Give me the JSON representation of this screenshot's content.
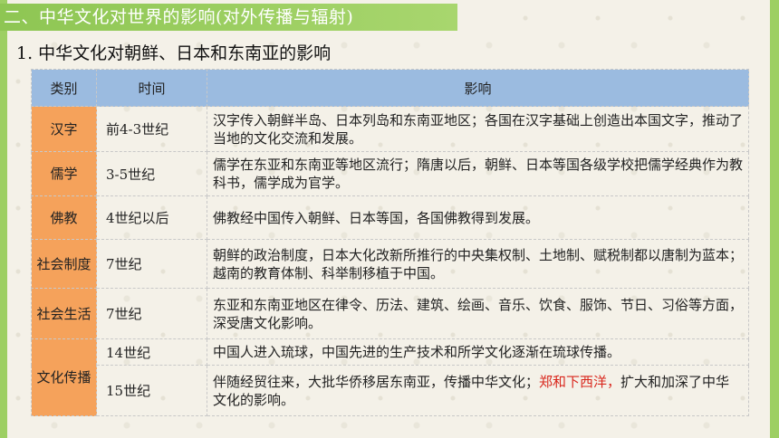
{
  "section_heading": "二、中华文化对世界的影响(对外传播与辐射)",
  "subtitle": "1. 中华文化对朝鲜、日本和东南亚的影响",
  "table": {
    "headers": {
      "category": "类别",
      "time": "时间",
      "effect": "影响"
    },
    "rows": [
      {
        "category": "汉字",
        "time": "前4-3世纪",
        "effect": "汉字传入朝鲜半岛、日本列岛和东南亚地区；各国在汉字基础上创造出本国文字，推动了当地的文化交流和发展。",
        "color": "black"
      },
      {
        "category": "儒学",
        "time": "3-5世纪",
        "effect": "儒学在东亚和东南亚等地区流行；隋唐以后，朝鲜、日本等国各级学校把儒学经典作为教科书，儒学成为官学。",
        "color": "purple"
      },
      {
        "category": "佛教",
        "time": "4世纪以后",
        "effect": "佛教经中国传入朝鲜、日本等国，各国佛教得到发展。",
        "color": "red"
      },
      {
        "category": "社会制度",
        "time": "7世纪",
        "effect": "朝鲜的政治制度，日本大化改新所推行的中央集权制、土地制、赋税制都以唐制为蓝本；越南的教育体制、科举制移植于中国。",
        "color": "black"
      },
      {
        "category": "社会生活",
        "time": "7世纪",
        "effect": "东亚和东南亚地区在律令、历法、建筑、绘画、音乐、饮食、服饰、节日、习俗等方面，深受唐文化影响。",
        "color": "purple"
      },
      {
        "category": "文化传播",
        "time": "14世纪",
        "effect": "中国人进入琉球，中国先进的生产技术和所学文化逐渐在琉球传播。",
        "color": "red"
      },
      {
        "time": "15世纪",
        "effect_part1": "伴随经贸往来，大批华侨移居东南亚，传播中华文化；",
        "effect_part2": "郑和下西洋，",
        "effect_part3": "扩大和加深了中华文化的影响。"
      }
    ]
  }
}
